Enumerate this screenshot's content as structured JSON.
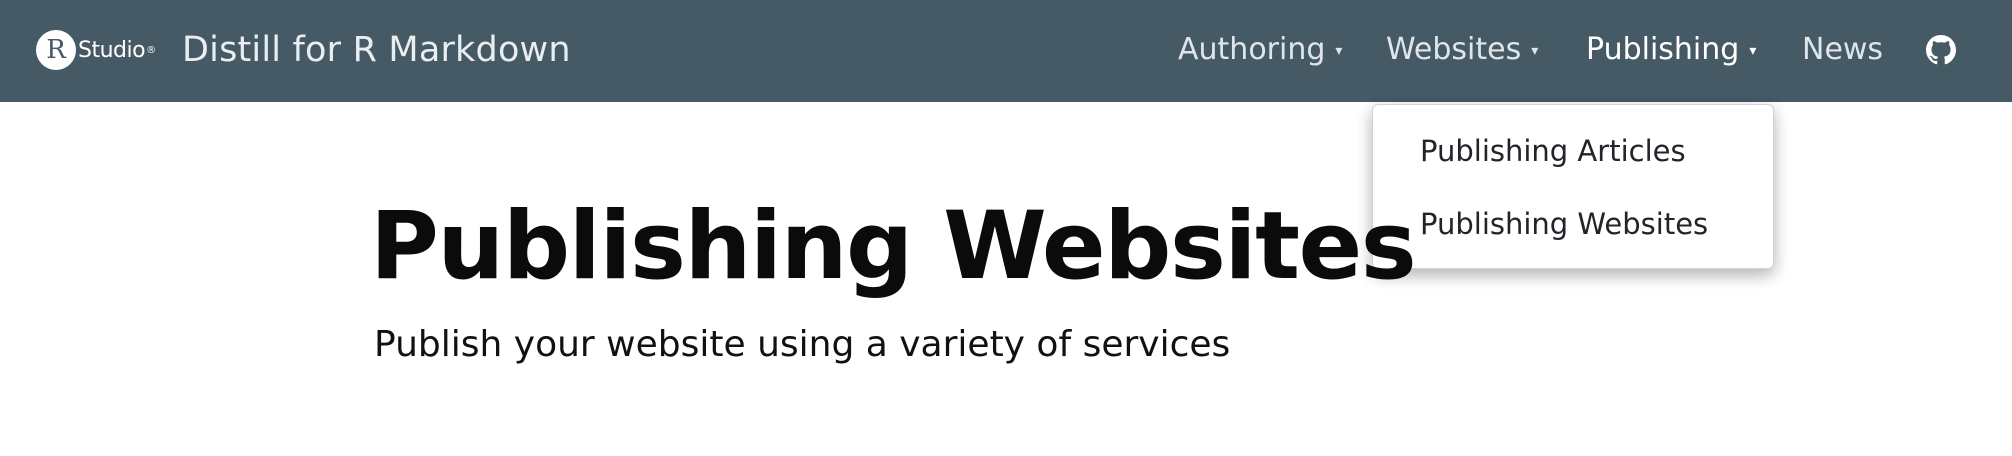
{
  "brand": {
    "logo_letter": "R",
    "logo_text": "Studio",
    "logo_trademark": "®"
  },
  "site_title": "Distill for R Markdown",
  "nav": {
    "authoring": {
      "label": "Authoring",
      "caret": "▾"
    },
    "websites": {
      "label": "Websites",
      "caret": "▾"
    },
    "publishing": {
      "label": "Publishing",
      "caret": "▾"
    },
    "news": {
      "label": "News"
    },
    "github_icon": "github-icon"
  },
  "dropdown": {
    "items": [
      {
        "label": "Publishing Articles"
      },
      {
        "label": "Publishing Websites"
      }
    ]
  },
  "page": {
    "title": "Publishing Websites",
    "subtitle": "Publish your website using a variety of services"
  },
  "colors": {
    "navbar_bg": "#455a64",
    "text_dark": "#0b0b0b",
    "dropdown_border": "#d4d4d4"
  }
}
